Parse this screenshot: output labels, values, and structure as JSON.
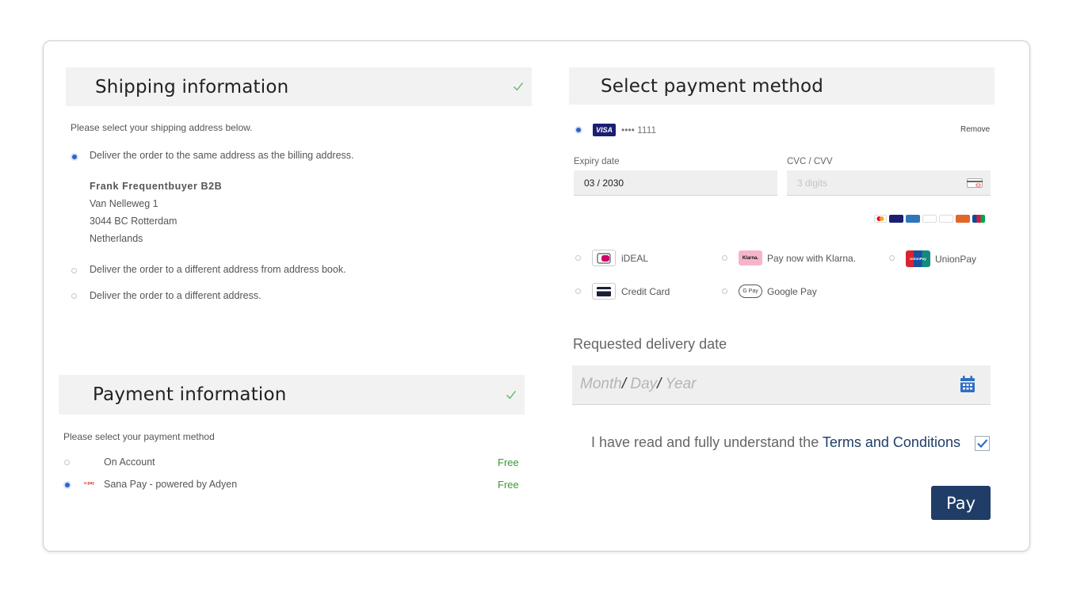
{
  "shipping": {
    "title": "Shipping information",
    "prompt": "Please select your shipping address below.",
    "options": [
      {
        "label": "Deliver the order to the same address as the billing address.",
        "selected": true
      },
      {
        "label": "Deliver the order to a different address from address book.",
        "selected": false
      },
      {
        "label": "Deliver the order to a different address.",
        "selected": false
      }
    ],
    "address": {
      "name": "Frank Frequentbuyer B2B",
      "street": "Van Nelleweg 1",
      "city": "3044 BC Rotterdam",
      "country": "Netherlands"
    }
  },
  "payment_info": {
    "title": "Payment information",
    "prompt": "Please select your payment method",
    "methods": [
      {
        "label": "On Account",
        "price": "Free",
        "selected": false
      },
      {
        "label": "Sana Pay - powered by Adyen",
        "price": "Free",
        "selected": true,
        "icon_text": "s-pay"
      }
    ]
  },
  "select_payment": {
    "title": "Select payment method",
    "saved_card": {
      "brand": "VISA",
      "masked": "•••• 1111",
      "remove_label": "Remove"
    },
    "expiry": {
      "label": "Expiry date",
      "value": "03 / 2030"
    },
    "cvc": {
      "label": "CVC / CVV",
      "placeholder": "3 digits"
    },
    "methods": [
      {
        "label": "iDEAL",
        "icon": "ideal-icon"
      },
      {
        "label": "Pay now with Klarna.",
        "icon": "klarna-icon",
        "icon_text": "Klarna."
      },
      {
        "label": "UnionPay",
        "icon": "unionpay-icon",
        "icon_text": "UnionPay"
      },
      {
        "label": "Credit Card",
        "icon": "credit-card-icon"
      },
      {
        "label": "Google Pay",
        "icon": "google-pay-icon",
        "icon_text": "G Pay"
      }
    ]
  },
  "delivery": {
    "label": "Requested delivery date",
    "month": "Month",
    "day": "Day",
    "year": "Year",
    "sep": "/"
  },
  "terms": {
    "prefix": "I have read and fully understand the",
    "link": "Terms and Conditions",
    "checked": true
  },
  "pay_label": "Pay",
  "colors": {
    "accent": "#1f3d66",
    "free": "#3a9a2f",
    "check": "#5cb85c",
    "radio": "#2f63c9",
    "calendar": "#2f6fc2"
  }
}
